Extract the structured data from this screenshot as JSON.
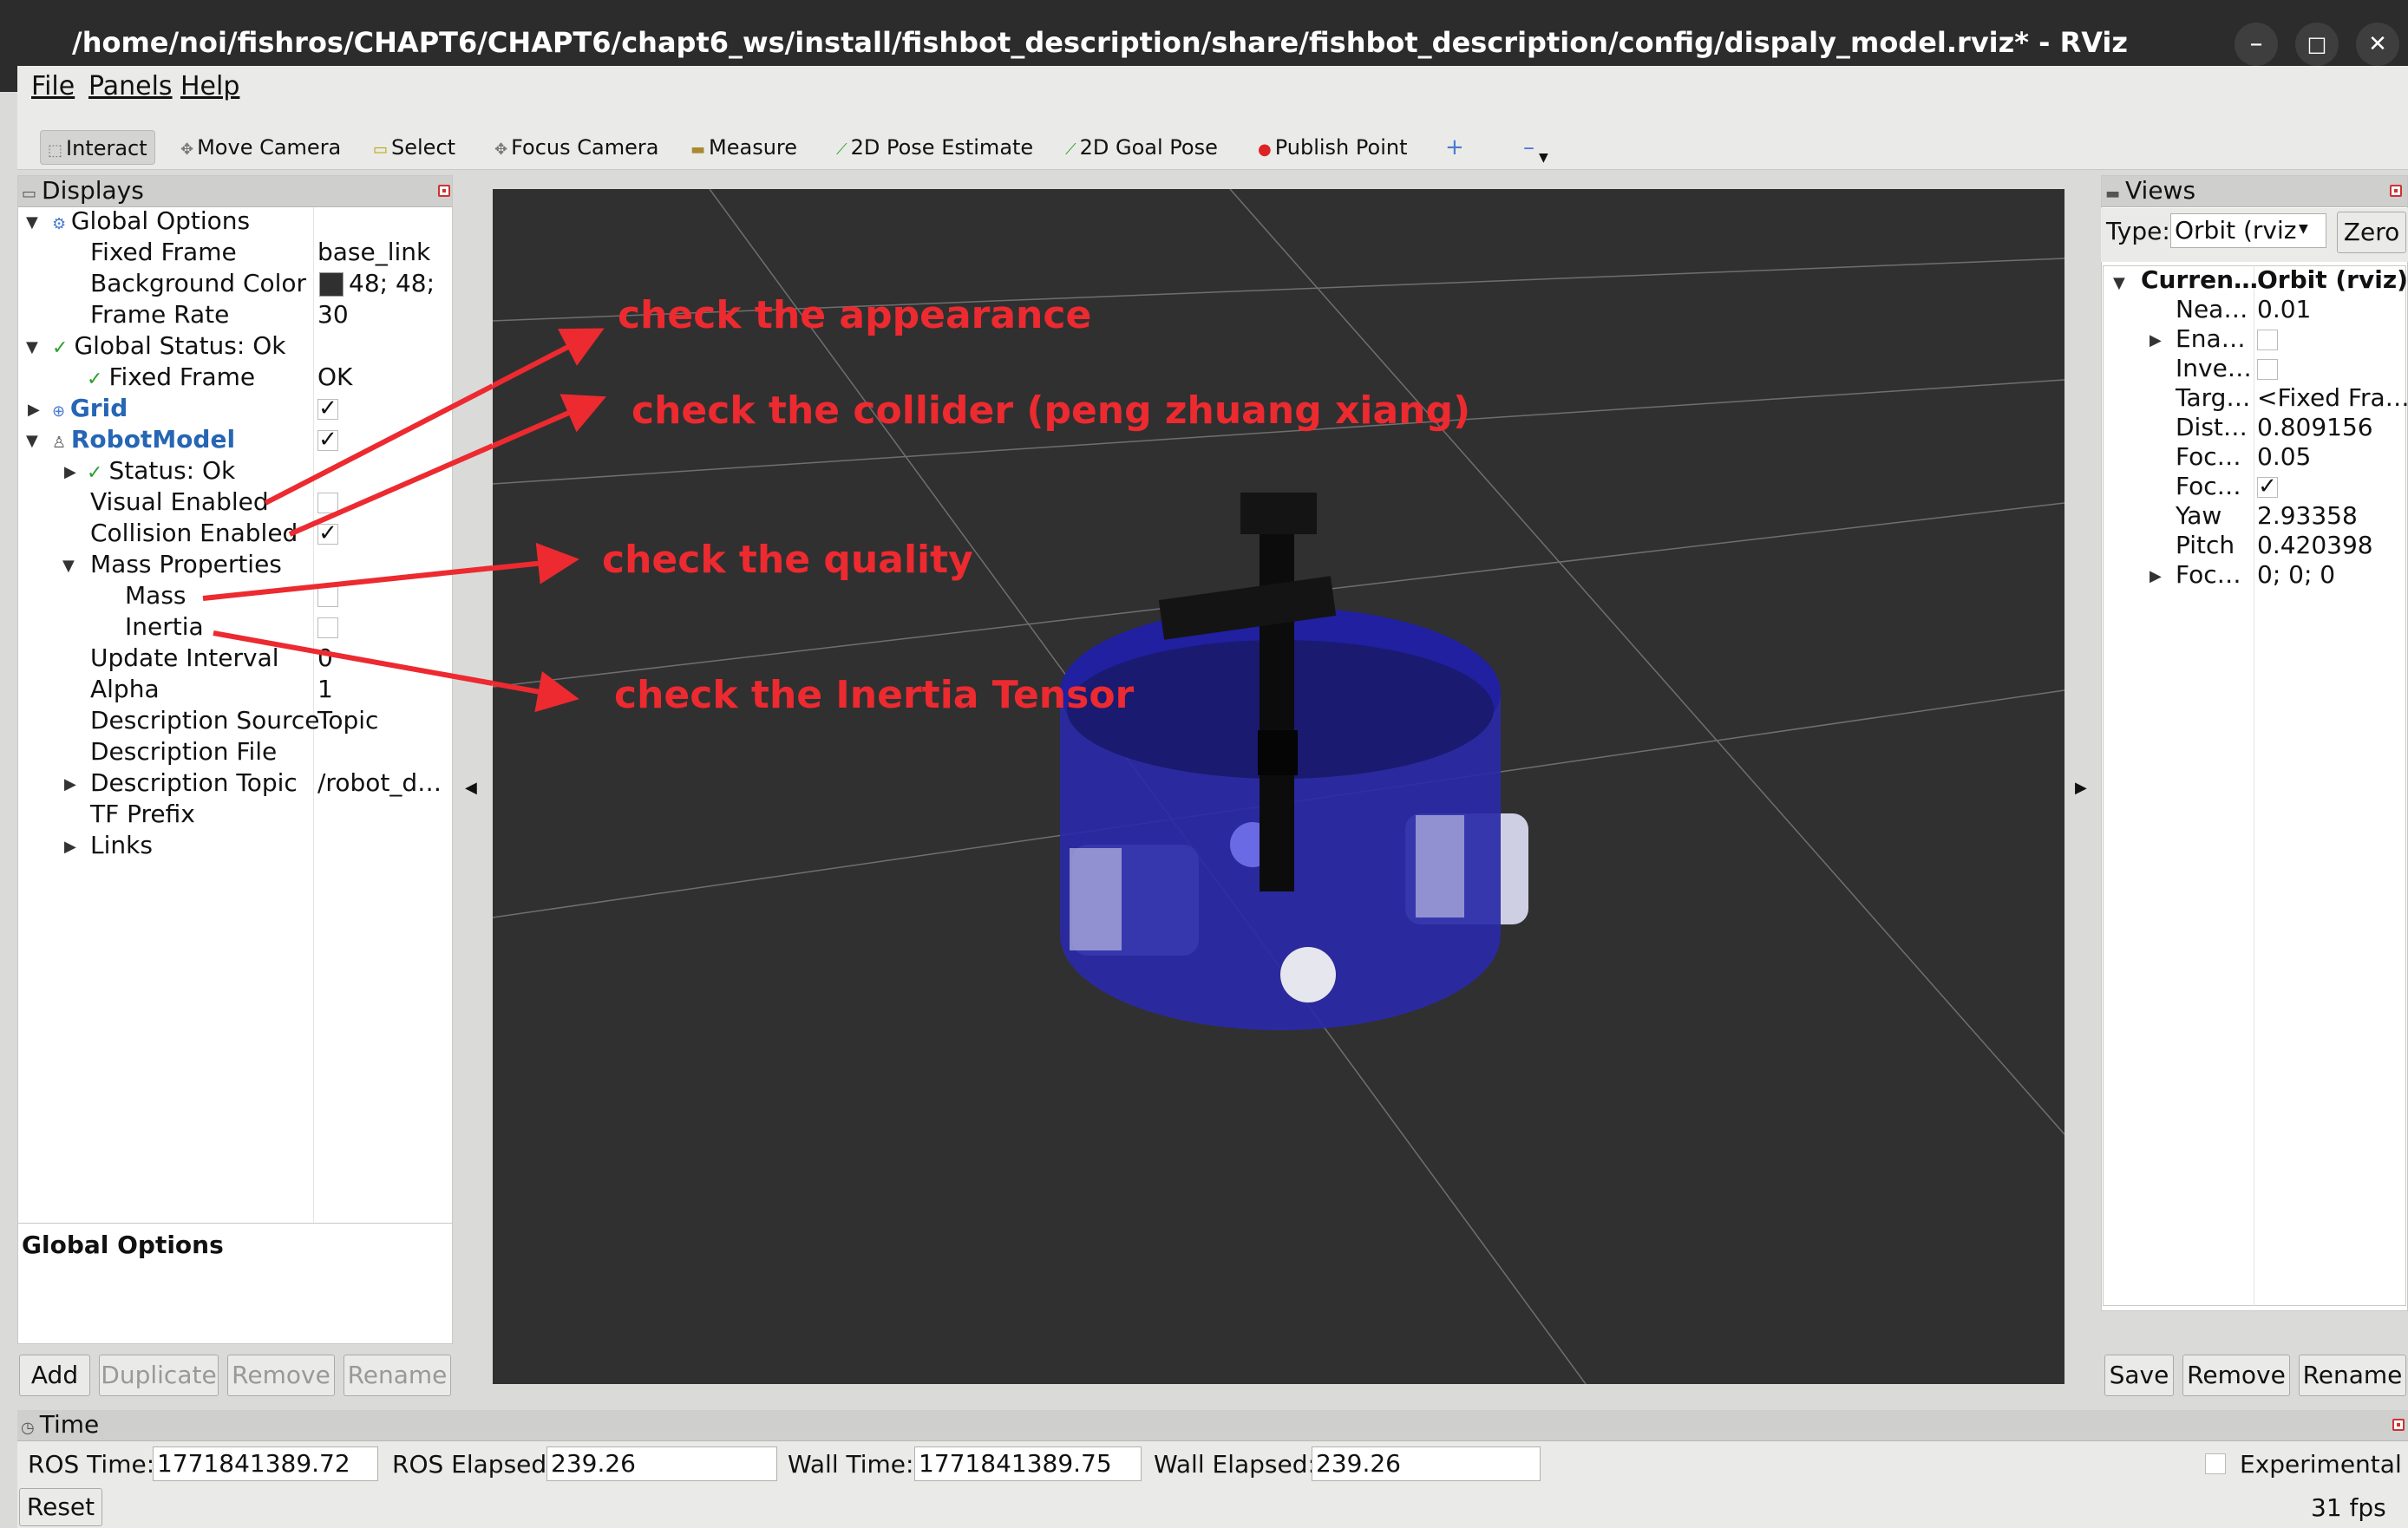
{
  "window": {
    "title": "/home/noi/fishros/CHAPT6/CHAPT6/chapt6_ws/install/fishbot_description/share/fishbot_description/config/dispaly_model.rviz* - RViz",
    "min": "–",
    "max": "□",
    "close": "✕"
  },
  "menu": {
    "file": "File",
    "panels": "Panels",
    "help": "Help"
  },
  "toolbar": {
    "interact": "Interact",
    "move_camera": "Move Camera",
    "select": "Select",
    "focus_camera": "Focus Camera",
    "measure": "Measure",
    "pose_estimate": "2D Pose Estimate",
    "goal_pose": "2D Goal Pose",
    "publish_point": "Publish Point",
    "plus": "+",
    "minus": "–"
  },
  "displays": {
    "header": "Displays",
    "global_options": "Global Options",
    "fixed_frame": "Fixed Frame",
    "fixed_frame_value": "base_link",
    "background_color": "Background Color",
    "background_color_value": "48; 48;",
    "frame_rate": "Frame Rate",
    "frame_rate_value": "30",
    "global_status": "Global Status: Ok",
    "fixed_frame_status": "Fixed Frame",
    "fixed_frame_status_value": "OK",
    "grid": "Grid",
    "robot_model": "RobotModel",
    "status_ok": "Status: Ok",
    "visual_enabled": "Visual Enabled",
    "collision_enabled": "Collision Enabled",
    "mass_properties": "Mass Properties",
    "mass": "Mass",
    "inertia": "Inertia",
    "update_interval": "Update Interval",
    "update_interval_value": "0",
    "alpha": "Alpha",
    "alpha_value": "1",
    "description_source": "Description Source",
    "description_source_value": "Topic",
    "description_file": "Description File",
    "description_topic": "Description Topic",
    "description_topic_value": "/robot_d…",
    "tf_prefix": "TF Prefix",
    "links": "Links",
    "check": "✓",
    "desc_title": "Global Options",
    "buttons": {
      "add": "Add",
      "duplicate": "Duplicate",
      "remove": "Remove",
      "rename": "Rename"
    }
  },
  "annotations": {
    "appearance": "check the appearance",
    "collider": "check the collider (peng zhuang xiang)",
    "quality": "check the quality",
    "inertia": "check the Inertia Tensor"
  },
  "views": {
    "header": "Views",
    "type_label": "Type:",
    "type_value": "Orbit (rviz",
    "zero": "Zero",
    "current_label": "Curren…",
    "current_value": "Orbit (rviz)",
    "near": "Nea…",
    "near_value": "0.01",
    "enable": "Ena…",
    "invert": "Inve…",
    "target": "Targ…",
    "target_value": "<Fixed Fra…",
    "distance": "Dist…",
    "distance_value": "0.809156",
    "focal_size": "Foc…",
    "focal_size_value": "0.05",
    "focal_shape": "Foc…",
    "focal_shape_value": "✓",
    "yaw": "Yaw",
    "yaw_value": "2.93358",
    "pitch": "Pitch",
    "pitch_value": "0.420398",
    "focal_point": "Foc…",
    "focal_point_value": "0; 0; 0",
    "buttons": {
      "save": "Save",
      "remove": "Remove",
      "rename": "Rename"
    }
  },
  "time": {
    "header": "Time",
    "ros_time_label": "ROS Time:",
    "ros_time": "1771841389.72",
    "ros_elapsed_label": "ROS Elapsed:",
    "ros_elapsed": "239.26",
    "wall_time_label": "Wall Time:",
    "wall_time": "1771841389.75",
    "wall_elapsed_label": "Wall Elapsed:",
    "wall_elapsed": "239.26",
    "experimental": "Experimental",
    "reset": "Reset",
    "fps": "31 fps"
  },
  "colors": {
    "annotation": "#ec2a30",
    "viewport_bg": "#303030",
    "robot_body": "#2a2aa8"
  }
}
